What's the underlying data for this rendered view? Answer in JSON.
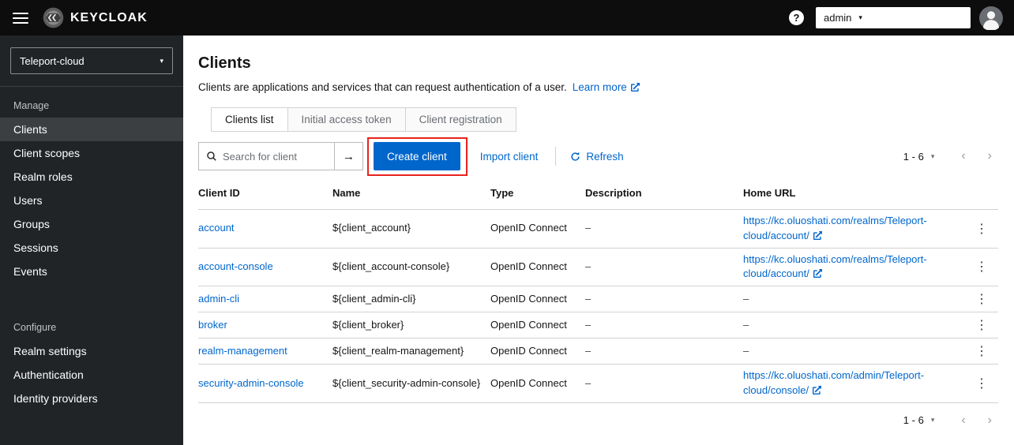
{
  "topbar": {
    "brand": "KEYCLOAK",
    "help_glyph": "?",
    "user_label": "admin"
  },
  "sidebar": {
    "realm": "Teleport-cloud",
    "sections": [
      {
        "label": "Manage",
        "items": [
          "Clients",
          "Client scopes",
          "Realm roles",
          "Users",
          "Groups",
          "Sessions",
          "Events"
        ]
      },
      {
        "label": "Configure",
        "items": [
          "Realm settings",
          "Authentication",
          "Identity providers"
        ]
      }
    ],
    "active_item": "Clients"
  },
  "main": {
    "title": "Clients",
    "subtitle": "Clients are applications and services that can request authentication of a user.",
    "learn_more": "Learn more",
    "tabs": [
      {
        "label": "Clients list",
        "active": true
      },
      {
        "label": "Initial access token",
        "active": false
      },
      {
        "label": "Client registration",
        "active": false
      }
    ],
    "toolbar": {
      "search_placeholder": "Search for client",
      "create_button": "Create client",
      "import_button": "Import client",
      "refresh_button": "Refresh",
      "pagination_label": "1 - 6"
    },
    "table": {
      "headers": [
        "Client ID",
        "Name",
        "Type",
        "Description",
        "Home URL"
      ],
      "rows": [
        {
          "client_id": "account",
          "name": "${client_account}",
          "type": "OpenID Connect",
          "description": "–",
          "home_url": "https://kc.oluoshati.com/realms/Teleport-cloud/account/"
        },
        {
          "client_id": "account-console",
          "name": "${client_account-console}",
          "type": "OpenID Connect",
          "description": "–",
          "home_url": "https://kc.oluoshati.com/realms/Teleport-cloud/account/"
        },
        {
          "client_id": "admin-cli",
          "name": "${client_admin-cli}",
          "type": "OpenID Connect",
          "description": "–",
          "home_url": "–"
        },
        {
          "client_id": "broker",
          "name": "${client_broker}",
          "type": "OpenID Connect",
          "description": "–",
          "home_url": "–"
        },
        {
          "client_id": "realm-management",
          "name": "${client_realm-management}",
          "type": "OpenID Connect",
          "description": "–",
          "home_url": "–"
        },
        {
          "client_id": "security-admin-console",
          "name": "${client_security-admin-console}",
          "type": "OpenID Connect",
          "description": "–",
          "home_url": "https://kc.oluoshati.com/admin/Teleport-cloud/console/"
        }
      ]
    },
    "pagination_bottom": "1 - 6"
  },
  "icons": {
    "caret_down": "▾",
    "arrow_right": "→",
    "kebab": "⋮",
    "chevron_left": "‹",
    "chevron_right": "›"
  },
  "colors": {
    "accent_blue": "#0066cc",
    "link_blue": "#0066cc",
    "topbar_bg": "#0d0d0d",
    "sidebar_bg": "#212427",
    "sidebar_active_bg": "#3c3f42",
    "annotation_red": "#e8231d"
  }
}
